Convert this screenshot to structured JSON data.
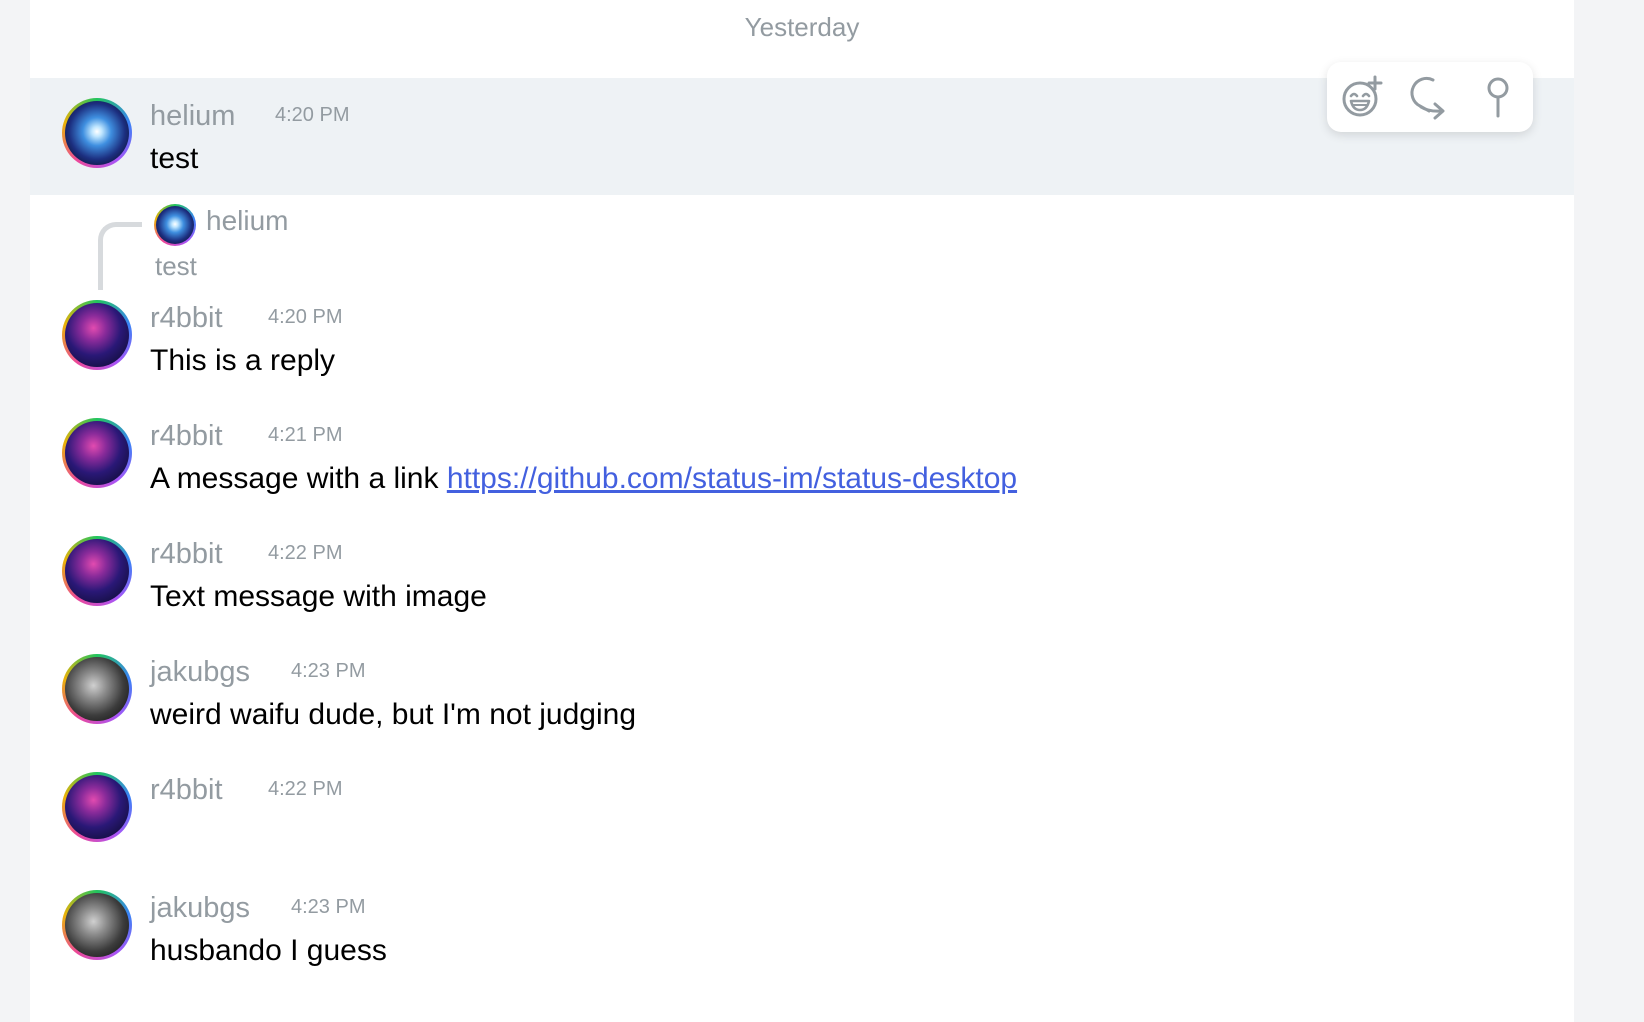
{
  "date_separator": "Yesterday",
  "toolbar": {
    "emoji_icon": "add-reaction-icon",
    "reply_icon": "reply-icon",
    "pin_icon": "pin-icon"
  },
  "messages": [
    {
      "author": "helium",
      "time": "4:20 PM",
      "text": "test"
    },
    {
      "reply_to": {
        "author": "helium",
        "text": "test"
      },
      "author": "r4bbit",
      "time": "4:20 PM",
      "text": "This is a reply"
    },
    {
      "author": "r4bbit",
      "time": "4:21 PM",
      "text": "A message with a link ",
      "link": "https://github.com/status-im/status-desktop"
    },
    {
      "author": "r4bbit",
      "time": "4:22 PM",
      "text": "Text message with image"
    },
    {
      "author": "jakubgs",
      "time": "4:23 PM",
      "text": "weird waifu dude, but I'm not judging"
    },
    {
      "author": "r4bbit",
      "time": "4:22 PM",
      "text": ""
    },
    {
      "author": "jakubgs",
      "time": "4:23 PM",
      "text": "husbando I guess"
    }
  ],
  "colors": {
    "accent_link": "#4360df",
    "secondary_text": "#939ba1",
    "hover_background": "#eef2f5"
  }
}
